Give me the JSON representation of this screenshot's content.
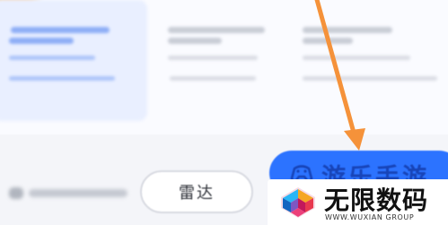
{
  "options": [
    {
      "selected": true
    },
    {
      "selected": false
    },
    {
      "selected": false
    }
  ],
  "tab_row": {
    "radar_label": "雷达"
  },
  "brand_pill": {
    "text": "游乐手游",
    "icon": "game-controller-icon",
    "color": "#2c73ff"
  },
  "watermark": {
    "title": "无限数码",
    "subtitle": "WWW.WUXIAN GROUP"
  },
  "annotation": {
    "color": "#f5923a"
  }
}
